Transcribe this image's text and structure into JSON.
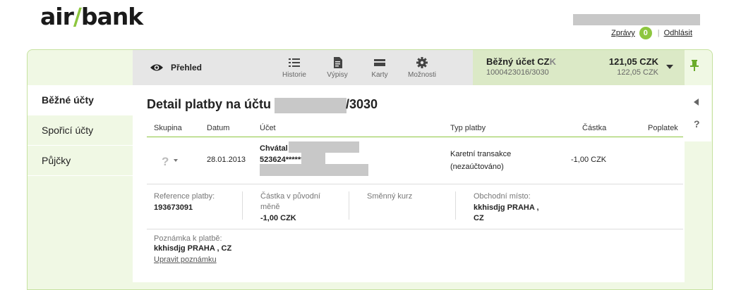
{
  "brand": {
    "logo_left": "air",
    "logo_slash": "/",
    "logo_right": "bank"
  },
  "header": {
    "messages_label": "Zprávy",
    "messages_count": "0",
    "separator": "|",
    "logout_label": "Odhlásit"
  },
  "nav": {
    "overview_label": "Přehled",
    "items": [
      {
        "label": "Historie",
        "icon": "list-icon"
      },
      {
        "label": "Výpisy",
        "icon": "document-icon"
      },
      {
        "label": "Karty",
        "icon": "card-icon"
      },
      {
        "label": "Možnosti",
        "icon": "gear-icon"
      }
    ]
  },
  "account": {
    "name_main": "Běžný účet CZ",
    "name_tail": "K",
    "number": "1000423016/3030",
    "balance": "121,05 CZK",
    "available": "122,05 CZK"
  },
  "sidebar": {
    "items": [
      {
        "label": "Běžné účty"
      },
      {
        "label": "Spořicí účty"
      },
      {
        "label": "Půjčky"
      }
    ]
  },
  "detail": {
    "title": "Detail platby na účtu",
    "title_suffix": "/3030",
    "columns": [
      "Skupina",
      "Datum",
      "Účet",
      "Typ platby",
      "Částka",
      "Poplatek"
    ],
    "row": {
      "group": "?",
      "date": "28.01.2013",
      "account_name": "Chvátal",
      "account_number": "523624******",
      "payment_type_line1": "Karetní transakce",
      "payment_type_line2": "(nezaúčtováno)",
      "amount": "-1,00 CZK"
    },
    "info": {
      "reference_label": "Reference platby:",
      "reference_value": "193673091",
      "orig_amount_label_1": "Částka v původní",
      "orig_amount_label_2": "měně",
      "orig_amount_value": "-1,00 CZK",
      "exchange_label": "Směnný kurz",
      "merchant_label": "Obchodní místo:",
      "merchant_value_1": "kkhisdjg PRAHA ,",
      "merchant_value_2": "CZ"
    },
    "note": {
      "label": "Poznámka k platbě:",
      "value": "kkhisdjg PRAHA , CZ",
      "edit_link": "Upravit poznámku"
    }
  },
  "colors": {
    "accent_green": "#8dc63f",
    "panel_green": "#f0f8e4",
    "account_bg": "#dbe9c6"
  }
}
